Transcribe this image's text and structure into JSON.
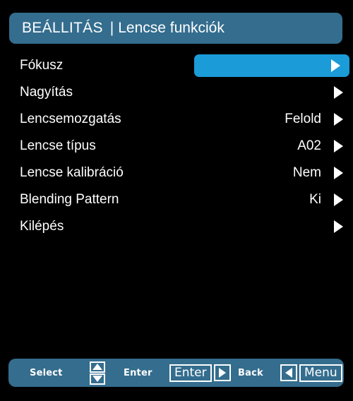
{
  "header": {
    "title": "BEÁLLITÁS",
    "separator": "|",
    "subtitle": "Lencse funkciók",
    "bar_color": "#346d8e"
  },
  "theme": {
    "background": "#000000",
    "highlight_color": "#1b9bd8",
    "bar_color": "#346d8e",
    "text_color": "#ffffff"
  },
  "menu": {
    "items": [
      {
        "label": "Fókusz",
        "value": "",
        "selected": true,
        "arrow": "chevron-right-icon"
      },
      {
        "label": "Nagyítás",
        "value": "",
        "selected": false,
        "arrow": "chevron-right-icon"
      },
      {
        "label": "Lencsemozgatás",
        "value": "Felold",
        "selected": false,
        "arrow": "chevron-right-icon"
      },
      {
        "label": "Lencse típus",
        "value": "A02",
        "selected": false,
        "arrow": "chevron-right-icon"
      },
      {
        "label": "Lencse kalibráció",
        "value": "Nem",
        "selected": false,
        "arrow": "chevron-right-icon"
      },
      {
        "label": "Blending Pattern",
        "value": "Ki",
        "selected": false,
        "arrow": "chevron-right-icon"
      },
      {
        "label": "Kilépés",
        "value": "",
        "selected": false,
        "arrow": "chevron-right-icon"
      }
    ]
  },
  "footer": {
    "select_label": "Select",
    "select_keys": {
      "up": "triangle-up-icon",
      "down": "triangle-down-icon"
    },
    "enter_label": "Enter",
    "enter_key_label": "Enter",
    "enter_key_arrow": "triangle-right-icon",
    "back_label": "Back",
    "back_key_arrow": "triangle-left-icon",
    "back_key_label": "Menu"
  }
}
